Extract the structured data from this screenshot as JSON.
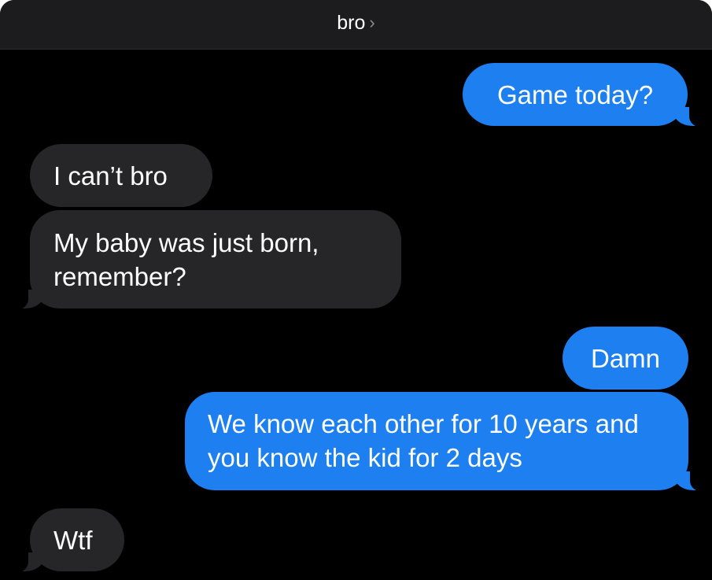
{
  "header": {
    "contact_name": "bro",
    "chevron": "›"
  },
  "messages": [
    {
      "direction": "sent",
      "text": "Game today?"
    },
    {
      "direction": "received",
      "text": "I can’t bro"
    },
    {
      "direction": "received",
      "text": "My baby was just born, remember?"
    },
    {
      "direction": "sent",
      "text": "Damn"
    },
    {
      "direction": "sent",
      "text": "We know each other for 10 years and you know the kid for 2 days"
    },
    {
      "direction": "received",
      "text": "Wtf"
    }
  ],
  "colors": {
    "background": "#000000",
    "header": "#1c1c1e",
    "sent_bubble": "#1e7ff0",
    "received_bubble": "#262628",
    "text": "#ffffff"
  }
}
